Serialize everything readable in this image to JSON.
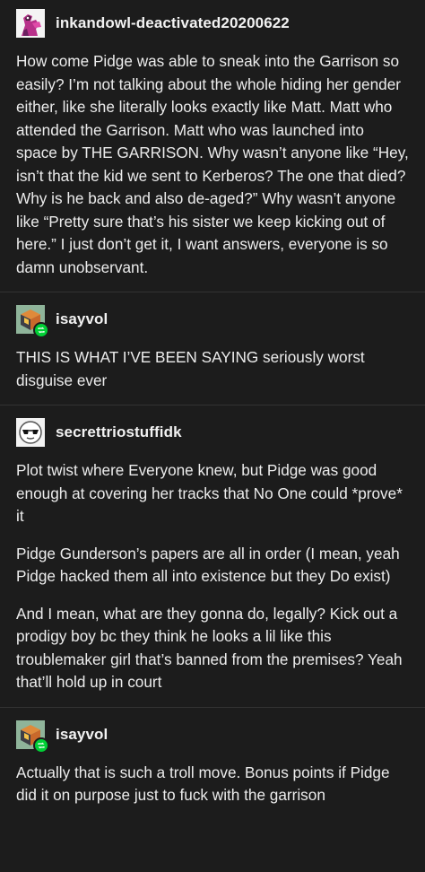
{
  "posts": [
    {
      "username": "inkandowl-deactivated20200622",
      "avatar_icon": "pink-character-avatar-icon",
      "reblog": false,
      "paragraphs": [
        "How come Pidge was able to sneak into the Garrison so easily? I’m not talking about the whole hiding her gender either, like she literally looks exactly like Matt.  Matt who attended the Garrison.  Matt who was launched into space by THE GARRISON.  Why wasn’t anyone like “Hey, isn’t that the kid we sent to Kerberos? The one that died? Why is he back and also de-aged?” Why wasn’t anyone like “Pretty sure that’s his sister we keep kicking out of here.” I just don’t get it, I want answers, everyone is so damn unobservant."
      ]
    },
    {
      "username": "isayvol",
      "avatar_icon": "isometric-cube-avatar-icon",
      "reblog": true,
      "paragraphs": [
        "THIS IS WHAT I’VE BEEN SAYING seriously worst disguise ever"
      ]
    },
    {
      "username": "secrettriostuffidk",
      "avatar_icon": "sunglasses-face-avatar-icon",
      "reblog": false,
      "paragraphs": [
        "Plot twist where Everyone knew, but Pidge was good enough at covering her tracks that No One could *prove* it",
        "Pidge Gunderson’s papers are all in order (I mean, yeah Pidge hacked them all into existence but they Do exist)",
        "And I mean, what are they gonna do, legally? Kick out a prodigy boy bc they think he looks a lil like this troublemaker girl that’s banned from the premises? Yeah that’ll hold up in court"
      ]
    },
    {
      "username": "isayvol",
      "avatar_icon": "isometric-cube-avatar-icon",
      "reblog": true,
      "paragraphs": [
        "Actually that is such a troll move. Bonus points if Pidge did it on purpose just to fuck with the garrison"
      ]
    }
  ],
  "colors": {
    "background": "#1c1c1c",
    "text": "#ececec",
    "divider": "#333333",
    "reblog_badge": "#00cf35"
  }
}
